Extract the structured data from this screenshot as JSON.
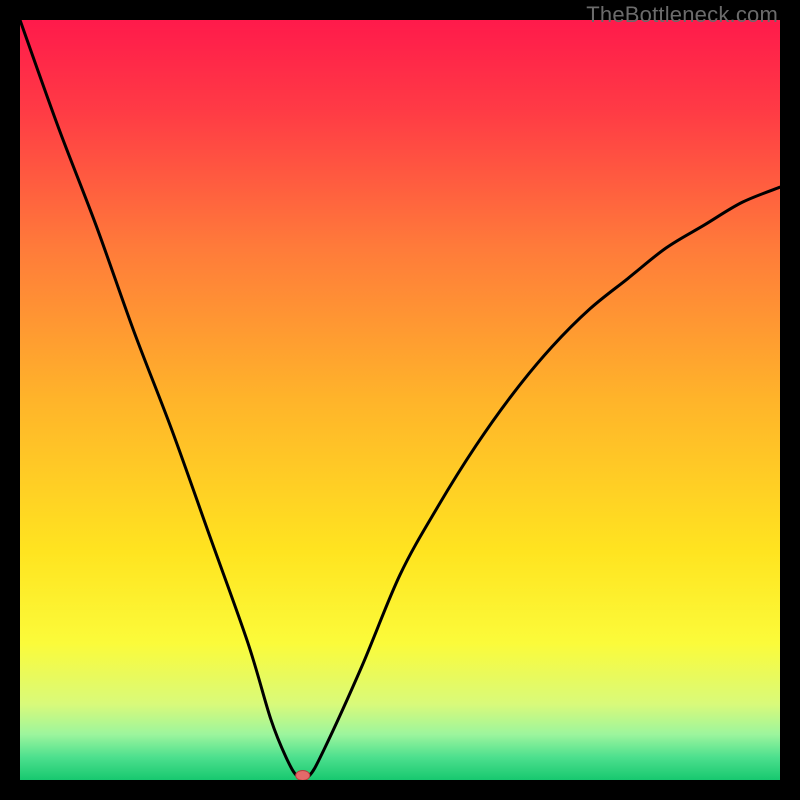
{
  "watermark": "TheBottleneck.com",
  "chart_data": {
    "type": "line",
    "title": "",
    "xlabel": "",
    "ylabel": "",
    "xlim": [
      0,
      100
    ],
    "ylim": [
      0,
      100
    ],
    "grid": false,
    "legend": false,
    "series": [
      {
        "name": "bottleneck-curve",
        "x": [
          0,
          5,
          10,
          15,
          20,
          25,
          30,
          33,
          35,
          36.5,
          38,
          40,
          45,
          50,
          55,
          60,
          65,
          70,
          75,
          80,
          85,
          90,
          95,
          100
        ],
        "y": [
          100,
          86,
          73,
          59,
          46,
          32,
          18,
          8,
          3,
          0.5,
          0.5,
          4,
          15,
          27,
          36,
          44,
          51,
          57,
          62,
          66,
          70,
          73,
          76,
          78
        ]
      }
    ],
    "marker": {
      "x": 37.2,
      "y": 0.6
    },
    "background_gradient": {
      "stops": [
        {
          "pct": 0,
          "color": "#ff1a4b"
        },
        {
          "pct": 12,
          "color": "#ff3b45"
        },
        {
          "pct": 30,
          "color": "#ff7b3a"
        },
        {
          "pct": 50,
          "color": "#ffb42a"
        },
        {
          "pct": 70,
          "color": "#ffe420"
        },
        {
          "pct": 82,
          "color": "#fbfb3a"
        },
        {
          "pct": 90,
          "color": "#d9fa7a"
        },
        {
          "pct": 94,
          "color": "#9cf59d"
        },
        {
          "pct": 97,
          "color": "#4de08e"
        },
        {
          "pct": 100,
          "color": "#17c86f"
        }
      ]
    }
  }
}
